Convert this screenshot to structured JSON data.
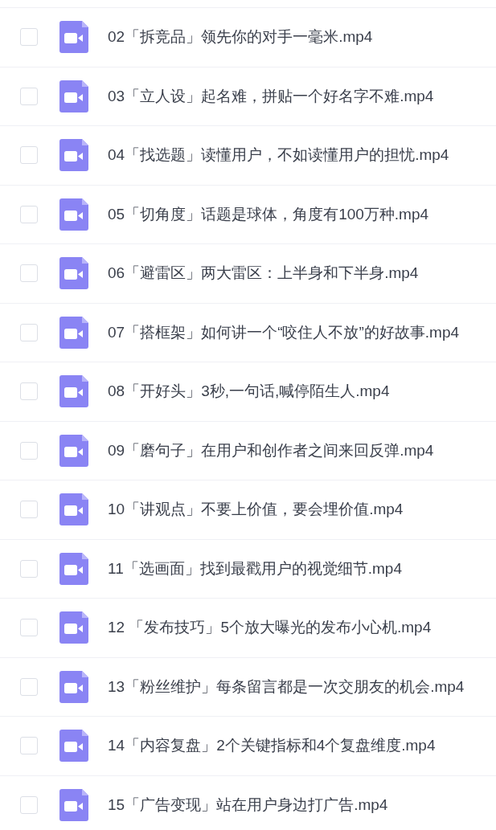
{
  "files": [
    {
      "name": "02「拆竞品」领先你的对手一毫米.mp4",
      "checked": false
    },
    {
      "name": "03「立人设」起名难，拼贴一个好名字不难.mp4",
      "checked": false
    },
    {
      "name": "04「找选题」读懂用户，不如读懂用户的担忧.mp4",
      "checked": false
    },
    {
      "name": "05「切角度」话题是球体，角度有100万种.mp4",
      "checked": false
    },
    {
      "name": "06「避雷区」两大雷区：上半身和下半身.mp4",
      "checked": false
    },
    {
      "name": "07「搭框架」如何讲一个“咬住人不放”的好故事.mp4",
      "checked": false
    },
    {
      "name": "08「开好头」3秒,一句话,喊停陌生人.mp4",
      "checked": false
    },
    {
      "name": "09「磨句子」在用户和创作者之间来回反弹.mp4",
      "checked": false
    },
    {
      "name": "10「讲观点」不要上价值，要会埋价值.mp4",
      "checked": false
    },
    {
      "name": "11「选画面」找到最戳用户的视觉细节.mp4",
      "checked": false
    },
    {
      "name": "12 「发布技巧」5个放大曝光的发布小心机.mp4",
      "checked": false
    },
    {
      "name": "13「粉丝维护」每条留言都是一次交朋友的机会.mp4",
      "checked": false
    },
    {
      "name": "14「内容复盘」2个关键指标和4个复盘维度.mp4",
      "checked": false
    },
    {
      "name": "15「广告变现」站在用户身边打广告.mp4",
      "checked": false
    }
  ]
}
